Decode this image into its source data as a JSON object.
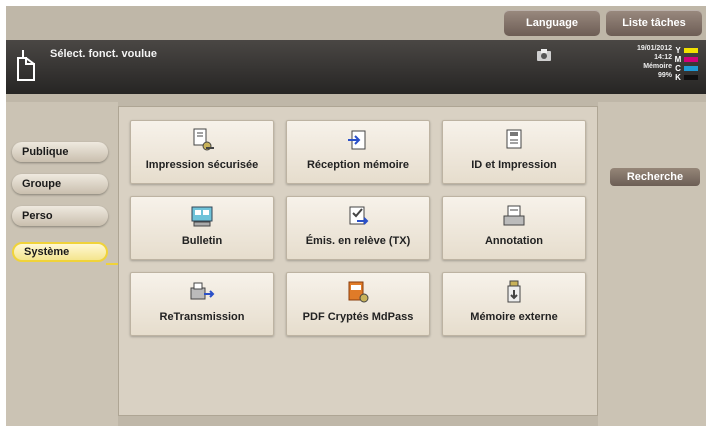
{
  "topbar": {
    "language_label": "Language",
    "tasks_label": "Liste tâches"
  },
  "header": {
    "title": "Sélect. fonct. voulue",
    "date": "19/01/2012",
    "time": "14:12",
    "memory_label": "Mémoire",
    "memory_value": "99%",
    "toner": [
      {
        "letter": "Y",
        "color": "#f2e100"
      },
      {
        "letter": "M",
        "color": "#d0007a"
      },
      {
        "letter": "C",
        "color": "#1f9ad6"
      },
      {
        "letter": "K",
        "color": "#111111"
      }
    ]
  },
  "categories": [
    {
      "label": "Publique",
      "active": false
    },
    {
      "label": "Groupe",
      "active": false
    },
    {
      "label": "Perso",
      "active": false
    },
    {
      "label": "Système",
      "active": true
    }
  ],
  "functions": [
    {
      "label": "Impression sécurisée",
      "icon": "secure-print-icon"
    },
    {
      "label": "Réception mémoire",
      "icon": "memory-receive-icon"
    },
    {
      "label": "ID et Impression",
      "icon": "id-print-icon"
    },
    {
      "label": "Bulletin",
      "icon": "bulletin-icon"
    },
    {
      "label": "Émis. en relève (TX)",
      "icon": "polling-tx-icon"
    },
    {
      "label": "Annotation",
      "icon": "annotation-icon"
    },
    {
      "label": "ReTransmission",
      "icon": "retransmission-icon"
    },
    {
      "label": "PDF Cryptés MdPass",
      "icon": "pdf-encrypted-icon"
    },
    {
      "label": "Mémoire externe",
      "icon": "external-memory-icon"
    }
  ],
  "side": {
    "search_label": "Recherche"
  }
}
